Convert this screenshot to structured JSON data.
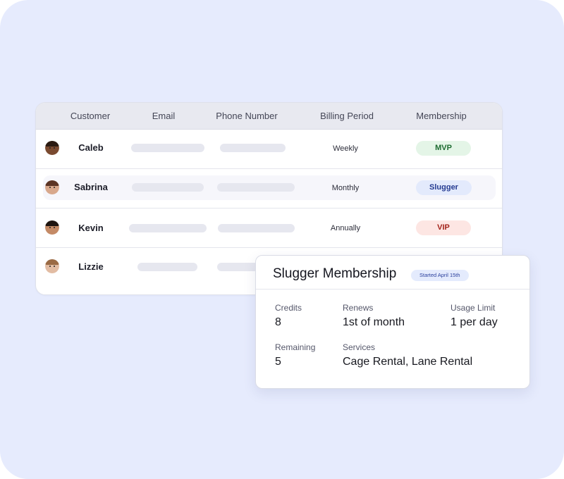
{
  "table": {
    "headers": {
      "customer": "Customer",
      "email": "Email",
      "phone": "Phone Number",
      "billing": "Billing Period",
      "membership": "Membership"
    },
    "rows": [
      {
        "name": "Caleb",
        "billing": "Weekly",
        "membership": "MVP",
        "avatar_icon": "customer-avatar-icon"
      },
      {
        "name": "Sabrina",
        "billing": "Monthly",
        "membership": "Slugger",
        "avatar_icon": "customer-avatar-icon"
      },
      {
        "name": "Kevin",
        "billing": "Annually",
        "membership": "VIP",
        "avatar_icon": "customer-avatar-icon"
      },
      {
        "name": "Lizzie",
        "billing": "",
        "membership": "",
        "avatar_icon": "customer-avatar-icon"
      }
    ]
  },
  "badge_colors": {
    "mvp": {
      "bg": "#e4f5e7",
      "fg": "#1d6b31"
    },
    "slugger": {
      "bg": "#e3eafc",
      "fg": "#243a91"
    },
    "vip": {
      "bg": "#fde6e3",
      "fg": "#a4241b"
    }
  },
  "detail": {
    "title": "Slugger Membership",
    "started": "Started April 15th",
    "credits": {
      "label": "Credits",
      "value": "8"
    },
    "renews": {
      "label": "Renews",
      "value": "1st of month"
    },
    "usage_limit": {
      "label": "Usage Limit",
      "value": "1 per day"
    },
    "remaining": {
      "label": "Remaining",
      "value": "5"
    },
    "services": {
      "label": "Services",
      "value": "Cage Rental, Lane Rental"
    }
  },
  "colors": {
    "background": "#e6ebfd",
    "card": "#ffffff",
    "header": "#e8e9f0",
    "skeleton": "#e6e7ef"
  }
}
